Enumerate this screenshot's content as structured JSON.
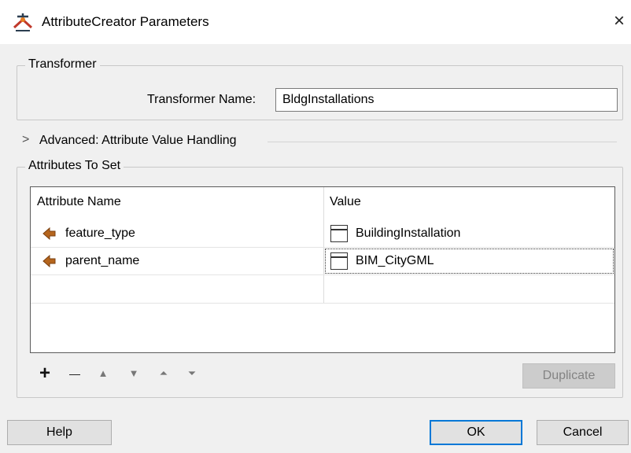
{
  "window": {
    "title": "AttributeCreator Parameters",
    "close_glyph": "×",
    "icon": "fme-attribute-creator-icon"
  },
  "transformer_group": {
    "legend": "Transformer",
    "name_label": "Transformer Name:",
    "name_value": "BldgInstallations"
  },
  "advanced": {
    "chevron": ">",
    "label": "Advanced: Attribute Value Handling",
    "expanded": false
  },
  "attributes_group": {
    "legend": "Attributes To Set",
    "columns": [
      "Attribute Name",
      "Value"
    ],
    "rows": [
      {
        "name": "feature_type",
        "value": "BuildingInstallation",
        "name_icon": "attribute-arrow-icon",
        "value_icon": "text-value-icon"
      },
      {
        "name": "parent_name",
        "value": "BIM_CityGML",
        "name_icon": "attribute-arrow-icon",
        "value_icon": "text-value-icon"
      }
    ],
    "empty_rows": 1
  },
  "toolbar": {
    "add": "+",
    "remove": "—",
    "move_up": "▲",
    "move_down": "▼",
    "move_top": "⏶",
    "move_bottom": "⏷",
    "duplicate_label": "Duplicate"
  },
  "footer": {
    "help_label": "Help",
    "ok_label": "OK",
    "cancel_label": "Cancel"
  },
  "colors": {
    "attr_icon": "#b5651d",
    "default_button_border": "#0078d7"
  }
}
